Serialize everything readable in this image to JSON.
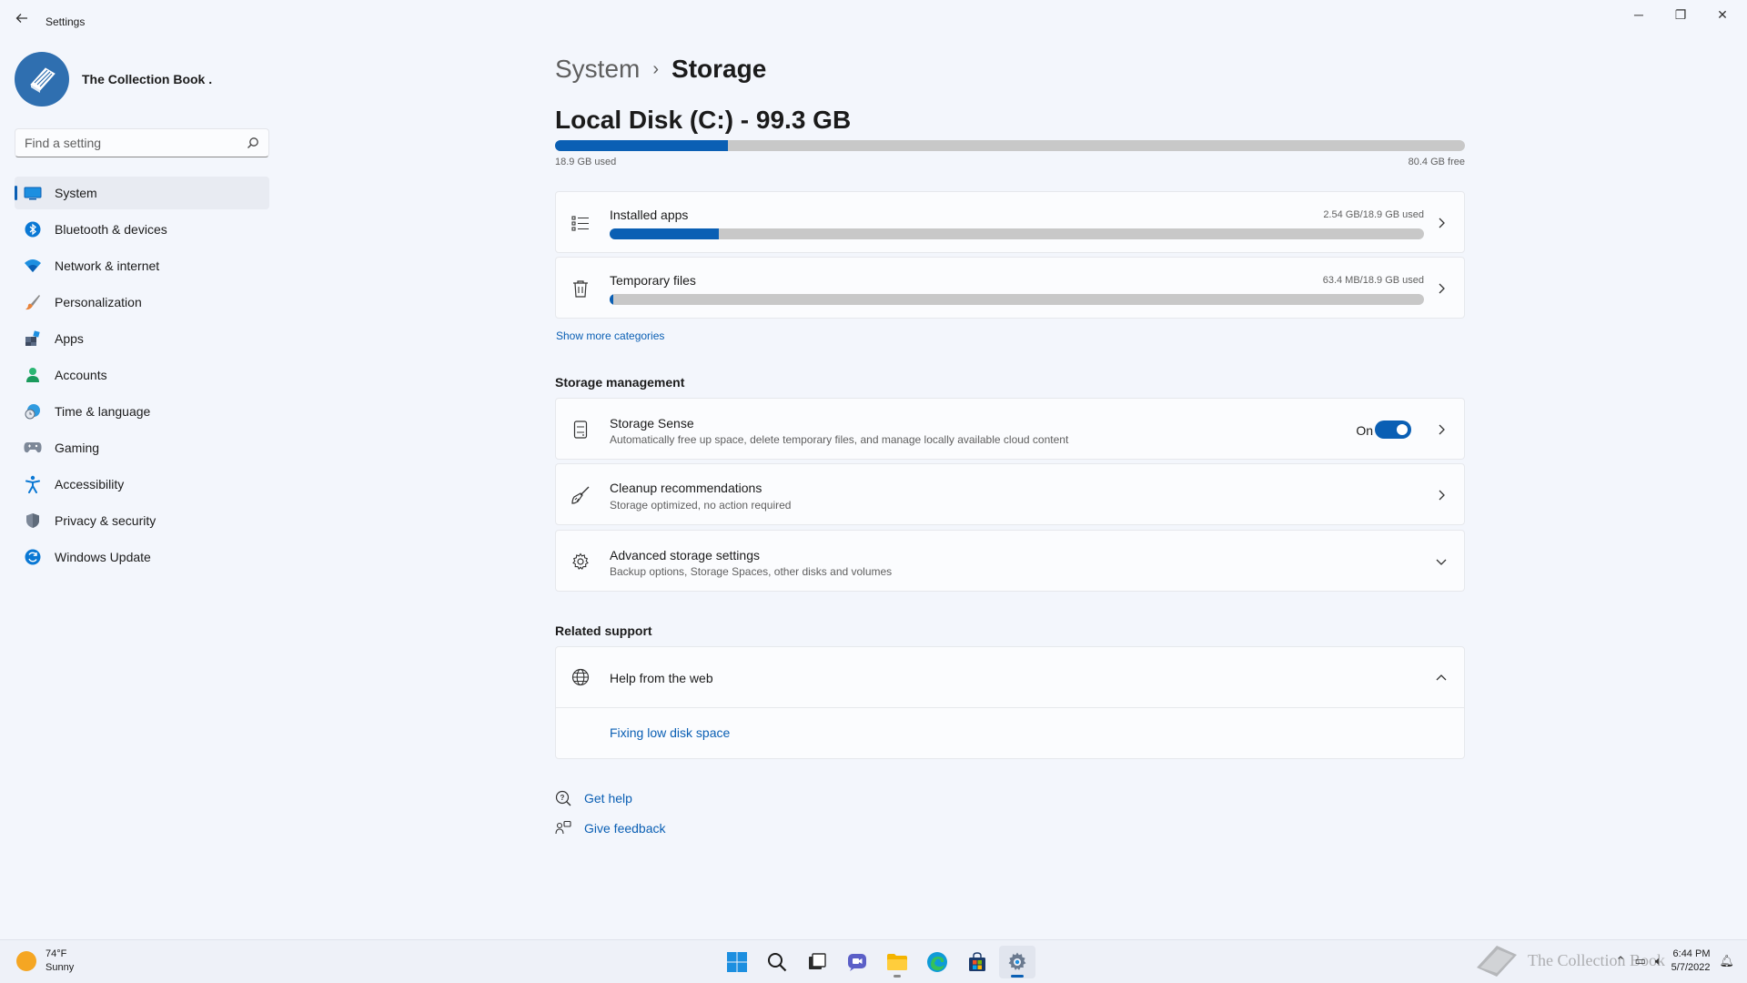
{
  "window": {
    "title": "Settings",
    "back_icon": "arrow-left-icon",
    "minimize_glyph": "─",
    "maximize_glyph": "❐",
    "close_glyph": "✕"
  },
  "profile": {
    "name": "The Collection Book .",
    "avatar_icon": "book-icon"
  },
  "search": {
    "placeholder": "Find a setting"
  },
  "sidebar": {
    "items": [
      {
        "label": "System",
        "icon": "system-icon",
        "active": true
      },
      {
        "label": "Bluetooth & devices",
        "icon": "bluetooth-icon"
      },
      {
        "label": "Network & internet",
        "icon": "wifi-icon"
      },
      {
        "label": "Personalization",
        "icon": "brush-icon"
      },
      {
        "label": "Apps",
        "icon": "apps-icon"
      },
      {
        "label": "Accounts",
        "icon": "person-icon"
      },
      {
        "label": "Time & language",
        "icon": "clock-globe-icon"
      },
      {
        "label": "Gaming",
        "icon": "gamepad-icon"
      },
      {
        "label": "Accessibility",
        "icon": "accessibility-icon"
      },
      {
        "label": "Privacy & security",
        "icon": "shield-icon"
      },
      {
        "label": "Windows Update",
        "icon": "update-icon"
      }
    ]
  },
  "breadcrumb": {
    "parent": "System",
    "separator": "›",
    "current": "Storage"
  },
  "disk": {
    "title": "Local Disk (C:) - 99.3 GB",
    "used_label": "18.9 GB used",
    "free_label": "80.4 GB free",
    "used_fraction": 0.19
  },
  "categories": {
    "installed_apps": {
      "title": "Installed apps",
      "usage": "2.54 GB/18.9 GB used",
      "fraction": 0.134
    },
    "temporary_files": {
      "title": "Temporary files",
      "usage": "63.4 MB/18.9 GB used",
      "fraction": 0.004
    },
    "show_more": "Show more categories"
  },
  "storage_management": {
    "heading": "Storage management",
    "storage_sense": {
      "title": "Storage Sense",
      "subtitle": "Automatically free up space, delete temporary files, and manage locally available cloud content",
      "toggle_label": "On",
      "toggle_on": true
    },
    "cleanup": {
      "title": "Cleanup recommendations",
      "subtitle": "Storage optimized, no action required"
    },
    "advanced": {
      "title": "Advanced storage settings",
      "subtitle": "Backup options, Storage Spaces, other disks and volumes"
    }
  },
  "related_support": {
    "heading": "Related support",
    "help_web": "Help from the web",
    "fixing_link": "Fixing low disk space"
  },
  "help": {
    "get_help": "Get help",
    "give_feedback": "Give feedback"
  },
  "taskbar": {
    "weather_temp": "74°F",
    "weather_desc": "Sunny",
    "time": "6:44 PM",
    "date": "5/7/2022",
    "watermark": "The Collection Book"
  },
  "colors": {
    "accent": "#0a5fb4",
    "bar_track": "#c8c8c8",
    "background": "#f3f6fc",
    "card": "#fbfcfe"
  }
}
